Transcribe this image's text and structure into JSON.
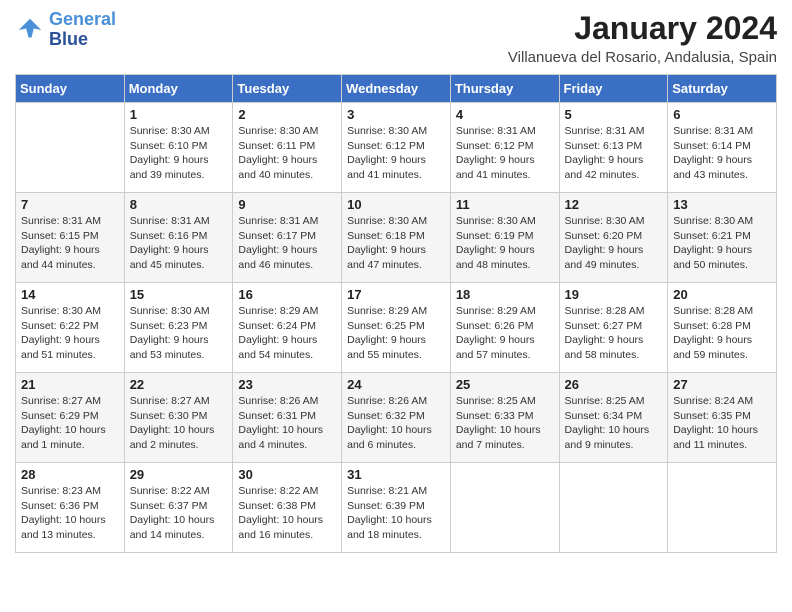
{
  "header": {
    "logo_line1": "General",
    "logo_line2": "Blue",
    "month_year": "January 2024",
    "location": "Villanueva del Rosario, Andalusia, Spain"
  },
  "days_of_week": [
    "Sunday",
    "Monday",
    "Tuesday",
    "Wednesday",
    "Thursday",
    "Friday",
    "Saturday"
  ],
  "weeks": [
    [
      {
        "day": "",
        "sunrise": "",
        "sunset": "",
        "daylight": ""
      },
      {
        "day": "1",
        "sunrise": "Sunrise: 8:30 AM",
        "sunset": "Sunset: 6:10 PM",
        "daylight": "Daylight: 9 hours and 39 minutes."
      },
      {
        "day": "2",
        "sunrise": "Sunrise: 8:30 AM",
        "sunset": "Sunset: 6:11 PM",
        "daylight": "Daylight: 9 hours and 40 minutes."
      },
      {
        "day": "3",
        "sunrise": "Sunrise: 8:30 AM",
        "sunset": "Sunset: 6:12 PM",
        "daylight": "Daylight: 9 hours and 41 minutes."
      },
      {
        "day": "4",
        "sunrise": "Sunrise: 8:31 AM",
        "sunset": "Sunset: 6:12 PM",
        "daylight": "Daylight: 9 hours and 41 minutes."
      },
      {
        "day": "5",
        "sunrise": "Sunrise: 8:31 AM",
        "sunset": "Sunset: 6:13 PM",
        "daylight": "Daylight: 9 hours and 42 minutes."
      },
      {
        "day": "6",
        "sunrise": "Sunrise: 8:31 AM",
        "sunset": "Sunset: 6:14 PM",
        "daylight": "Daylight: 9 hours and 43 minutes."
      }
    ],
    [
      {
        "day": "7",
        "sunrise": "Sunrise: 8:31 AM",
        "sunset": "Sunset: 6:15 PM",
        "daylight": "Daylight: 9 hours and 44 minutes."
      },
      {
        "day": "8",
        "sunrise": "Sunrise: 8:31 AM",
        "sunset": "Sunset: 6:16 PM",
        "daylight": "Daylight: 9 hours and 45 minutes."
      },
      {
        "day": "9",
        "sunrise": "Sunrise: 8:31 AM",
        "sunset": "Sunset: 6:17 PM",
        "daylight": "Daylight: 9 hours and 46 minutes."
      },
      {
        "day": "10",
        "sunrise": "Sunrise: 8:30 AM",
        "sunset": "Sunset: 6:18 PM",
        "daylight": "Daylight: 9 hours and 47 minutes."
      },
      {
        "day": "11",
        "sunrise": "Sunrise: 8:30 AM",
        "sunset": "Sunset: 6:19 PM",
        "daylight": "Daylight: 9 hours and 48 minutes."
      },
      {
        "day": "12",
        "sunrise": "Sunrise: 8:30 AM",
        "sunset": "Sunset: 6:20 PM",
        "daylight": "Daylight: 9 hours and 49 minutes."
      },
      {
        "day": "13",
        "sunrise": "Sunrise: 8:30 AM",
        "sunset": "Sunset: 6:21 PM",
        "daylight": "Daylight: 9 hours and 50 minutes."
      }
    ],
    [
      {
        "day": "14",
        "sunrise": "Sunrise: 8:30 AM",
        "sunset": "Sunset: 6:22 PM",
        "daylight": "Daylight: 9 hours and 51 minutes."
      },
      {
        "day": "15",
        "sunrise": "Sunrise: 8:30 AM",
        "sunset": "Sunset: 6:23 PM",
        "daylight": "Daylight: 9 hours and 53 minutes."
      },
      {
        "day": "16",
        "sunrise": "Sunrise: 8:29 AM",
        "sunset": "Sunset: 6:24 PM",
        "daylight": "Daylight: 9 hours and 54 minutes."
      },
      {
        "day": "17",
        "sunrise": "Sunrise: 8:29 AM",
        "sunset": "Sunset: 6:25 PM",
        "daylight": "Daylight: 9 hours and 55 minutes."
      },
      {
        "day": "18",
        "sunrise": "Sunrise: 8:29 AM",
        "sunset": "Sunset: 6:26 PM",
        "daylight": "Daylight: 9 hours and 57 minutes."
      },
      {
        "day": "19",
        "sunrise": "Sunrise: 8:28 AM",
        "sunset": "Sunset: 6:27 PM",
        "daylight": "Daylight: 9 hours and 58 minutes."
      },
      {
        "day": "20",
        "sunrise": "Sunrise: 8:28 AM",
        "sunset": "Sunset: 6:28 PM",
        "daylight": "Daylight: 9 hours and 59 minutes."
      }
    ],
    [
      {
        "day": "21",
        "sunrise": "Sunrise: 8:27 AM",
        "sunset": "Sunset: 6:29 PM",
        "daylight": "Daylight: 10 hours and 1 minute."
      },
      {
        "day": "22",
        "sunrise": "Sunrise: 8:27 AM",
        "sunset": "Sunset: 6:30 PM",
        "daylight": "Daylight: 10 hours and 2 minutes."
      },
      {
        "day": "23",
        "sunrise": "Sunrise: 8:26 AM",
        "sunset": "Sunset: 6:31 PM",
        "daylight": "Daylight: 10 hours and 4 minutes."
      },
      {
        "day": "24",
        "sunrise": "Sunrise: 8:26 AM",
        "sunset": "Sunset: 6:32 PM",
        "daylight": "Daylight: 10 hours and 6 minutes."
      },
      {
        "day": "25",
        "sunrise": "Sunrise: 8:25 AM",
        "sunset": "Sunset: 6:33 PM",
        "daylight": "Daylight: 10 hours and 7 minutes."
      },
      {
        "day": "26",
        "sunrise": "Sunrise: 8:25 AM",
        "sunset": "Sunset: 6:34 PM",
        "daylight": "Daylight: 10 hours and 9 minutes."
      },
      {
        "day": "27",
        "sunrise": "Sunrise: 8:24 AM",
        "sunset": "Sunset: 6:35 PM",
        "daylight": "Daylight: 10 hours and 11 minutes."
      }
    ],
    [
      {
        "day": "28",
        "sunrise": "Sunrise: 8:23 AM",
        "sunset": "Sunset: 6:36 PM",
        "daylight": "Daylight: 10 hours and 13 minutes."
      },
      {
        "day": "29",
        "sunrise": "Sunrise: 8:22 AM",
        "sunset": "Sunset: 6:37 PM",
        "daylight": "Daylight: 10 hours and 14 minutes."
      },
      {
        "day": "30",
        "sunrise": "Sunrise: 8:22 AM",
        "sunset": "Sunset: 6:38 PM",
        "daylight": "Daylight: 10 hours and 16 minutes."
      },
      {
        "day": "31",
        "sunrise": "Sunrise: 8:21 AM",
        "sunset": "Sunset: 6:39 PM",
        "daylight": "Daylight: 10 hours and 18 minutes."
      },
      {
        "day": "",
        "sunrise": "",
        "sunset": "",
        "daylight": ""
      },
      {
        "day": "",
        "sunrise": "",
        "sunset": "",
        "daylight": ""
      },
      {
        "day": "",
        "sunrise": "",
        "sunset": "",
        "daylight": ""
      }
    ]
  ]
}
